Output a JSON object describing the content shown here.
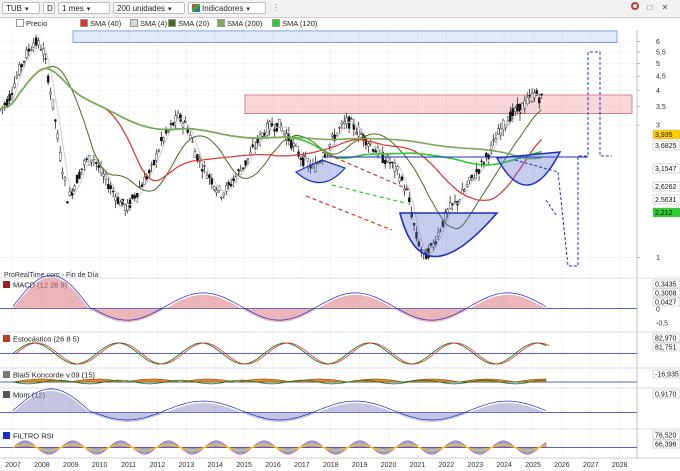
{
  "toolbar": {
    "symbol": "TUB",
    "chart_mode": "D",
    "period": "1 mes",
    "units": "200 unidades",
    "indicators": "Indicadores"
  },
  "legend": [
    {
      "label": "Precio",
      "color": "#ffffff"
    },
    {
      "label": "SMA (40)",
      "color": "#e0302a"
    },
    {
      "label": "SMA (4)",
      "color": "#d8d8d8"
    },
    {
      "label": "SMA (20)",
      "color": "#4a6b1f"
    },
    {
      "label": "SMA (200)",
      "color": "#7ca85a"
    },
    {
      "label": "SMA (120)",
      "color": "#2ecc2e"
    }
  ],
  "watermark": "ProRealTime.com - Fin de Día",
  "chart_data": [
    {
      "type": "candlestick",
      "title": "TUB",
      "x_axis": {
        "labels": [
          "2007",
          "2008",
          "2009",
          "2010",
          "2011",
          "2012",
          "2013",
          "2014",
          "2015",
          "2016",
          "2017",
          "2018",
          "2019",
          "2020",
          "2021",
          "2022",
          "2023",
          "2024",
          "2025",
          "2026",
          "2027",
          "2028"
        ]
      },
      "y_axis": {
        "scale": "log",
        "labels": [
          "6",
          "5,5",
          "5",
          "4,5",
          "4",
          "3,5",
          "3",
          "1"
        ]
      },
      "price_labels": [
        {
          "text": "3,935",
          "color": "#ffd000"
        },
        {
          "text": "3,6825",
          "color": "#ffffff"
        },
        {
          "text": "3,1547",
          "color": "#ffffff"
        },
        {
          "text": "2,6262",
          "color": "#ffffff"
        },
        {
          "text": "2,5631",
          "color": "#ffffff"
        },
        {
          "text": "2,212",
          "color": "#2ecc2e"
        }
      ],
      "series_monthly_close": [
        3.4,
        3.7,
        4.5,
        5.3,
        6.0,
        5.7,
        3.9,
        2.4,
        1.6,
        1.9,
        2.2,
        2.3,
        2.0,
        1.8,
        1.6,
        1.5,
        1.7,
        1.9,
        2.1,
        2.6,
        2.9,
        3.2,
        3.0,
        2.4,
        2.1,
        1.9,
        1.7,
        1.8,
        2.0,
        2.2,
        2.5,
        2.8,
        3.0,
        3.0,
        2.7,
        2.4,
        2.2,
        2.1,
        2.3,
        2.6,
        2.9,
        3.1,
        2.9,
        2.7,
        2.5,
        2.3,
        2.2,
        2.0,
        1.7,
        1.2,
        1.0,
        1.1,
        1.3,
        1.5,
        1.6,
        1.8,
        2.0,
        2.2,
        2.5,
        2.9,
        3.2,
        3.4,
        3.6,
        3.9,
        3.7
      ]
    },
    {
      "type": "line",
      "title": "MACD (12 26 9)",
      "value_labels": [
        "0,3435",
        "0,3008",
        "0,0427"
      ],
      "y_axis": {
        "labels": [
          "0",
          "-0,5"
        ]
      }
    },
    {
      "type": "line",
      "title": "Estocástico (26 8 5)",
      "value_labels": [
        "82,970",
        "81,751"
      ]
    },
    {
      "type": "area",
      "title": "Blai5 Koncorde v.09 (15)",
      "value_labels": [
        "-16,935"
      ]
    },
    {
      "type": "area",
      "title": "Mom (12)",
      "value_labels": [
        "0,9170"
      ]
    },
    {
      "type": "area",
      "title": "FILTRO RSI",
      "value_labels": [
        "76,520",
        "66,396"
      ]
    }
  ]
}
